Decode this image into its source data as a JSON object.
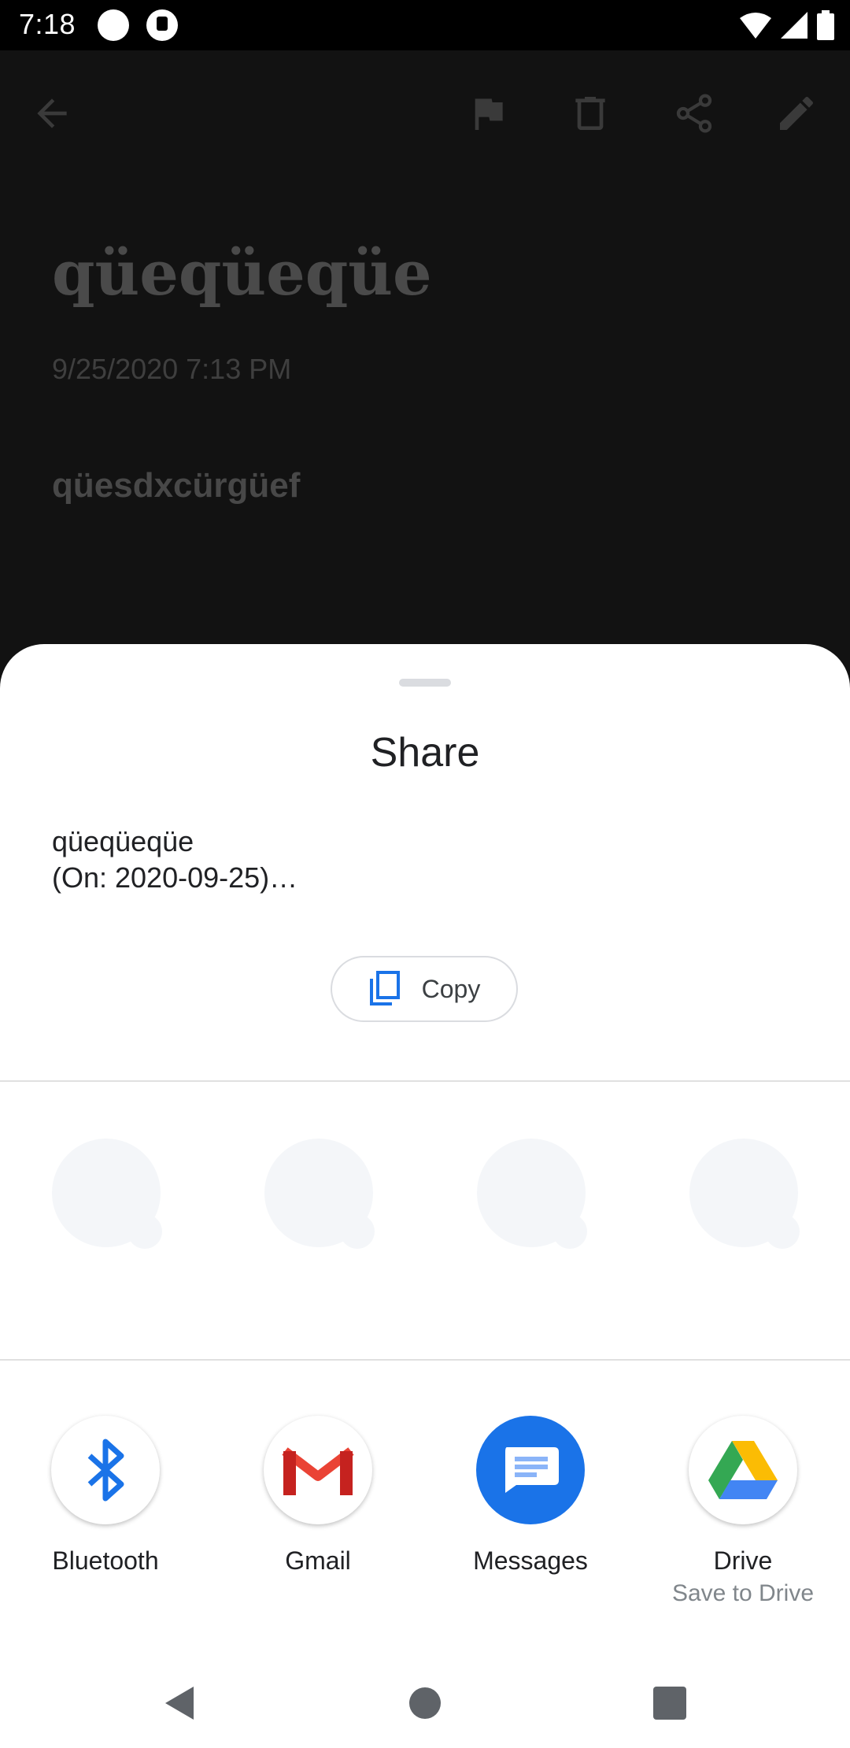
{
  "status_bar": {
    "time": "7:18"
  },
  "note": {
    "title": "qüeqüeqüe",
    "date": "9/25/2020 7:13 PM",
    "body": "qüesdxcürgüef"
  },
  "share_sheet": {
    "title": "Share",
    "preview_line1": "qüeqüeqüe",
    "preview_line2": "(On: 2020-09-25)…",
    "copy_label": "Copy",
    "targets": [
      {
        "label": "Bluetooth",
        "icon": "bluetooth-icon"
      },
      {
        "label": "Gmail",
        "icon": "gmail-icon"
      },
      {
        "label": "Messages",
        "icon": "messages-icon"
      },
      {
        "label": "Drive",
        "sublabel": "Save to Drive",
        "icon": "drive-icon"
      }
    ]
  },
  "colors": {
    "accent_blue": "#1a73e8",
    "scrim": "#121212",
    "sheet": "#ffffff"
  }
}
